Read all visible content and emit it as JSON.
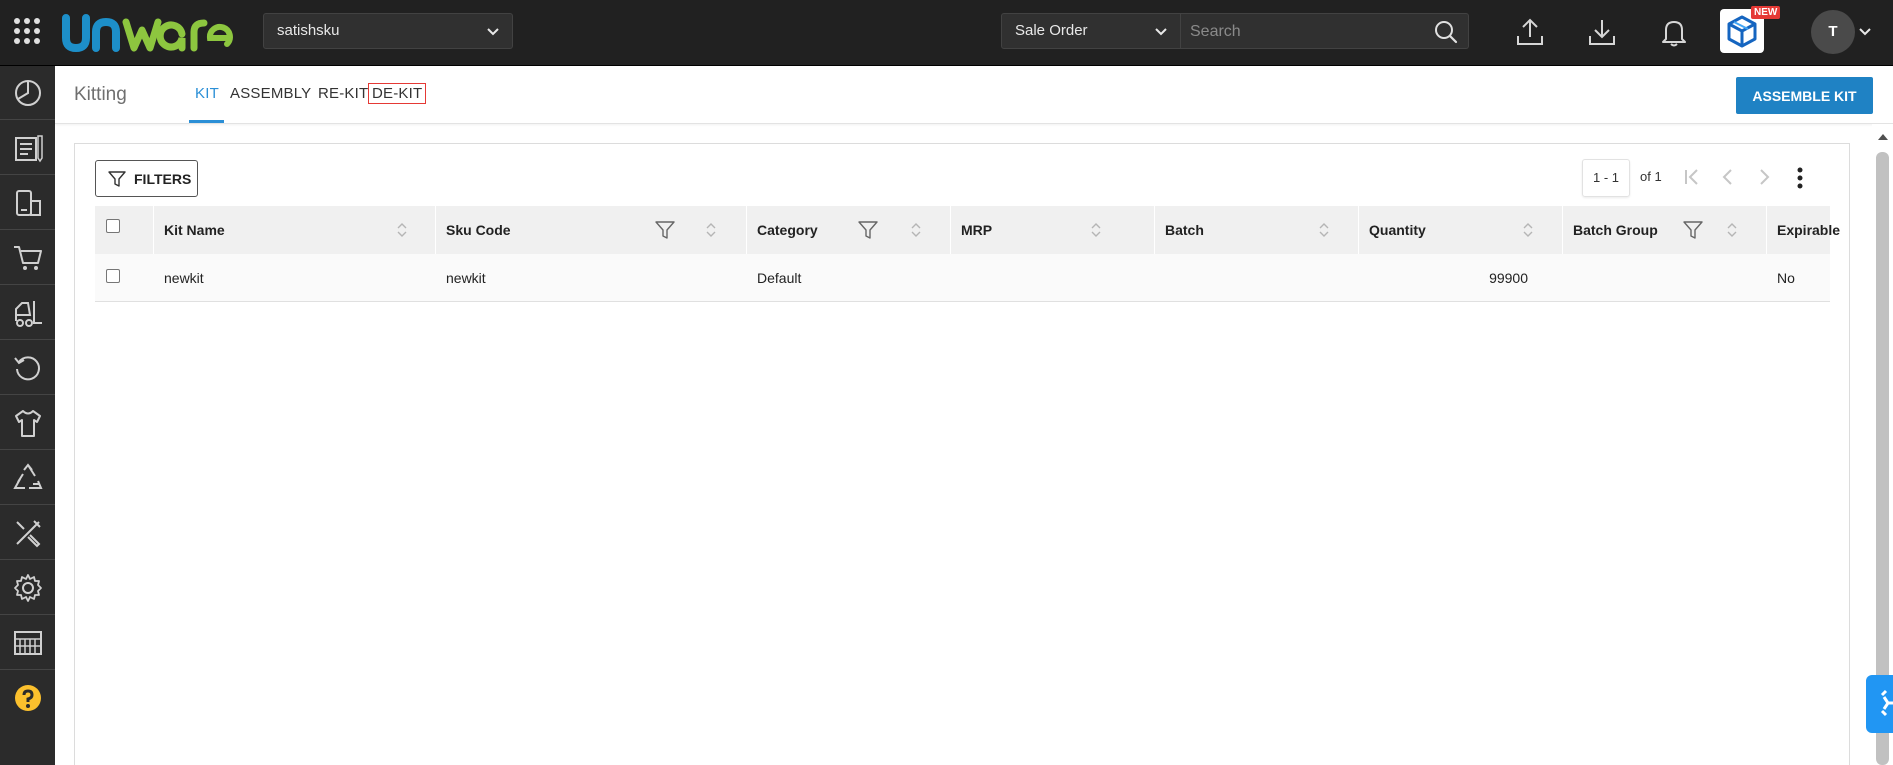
{
  "topbar": {
    "facility": "satishsku",
    "search_type": "Sale Order",
    "search_placeholder": "Search",
    "new_badge": "NEW",
    "avatar_initial": "T"
  },
  "header": {
    "title": "Kitting",
    "tabs": [
      {
        "label": "KIT",
        "active": true
      },
      {
        "label": "ASSEMBLY",
        "active": false
      },
      {
        "label": "RE-KIT",
        "active": false
      },
      {
        "label": "DE-KIT",
        "active": false
      }
    ],
    "primary_action": "ASSEMBLE KIT"
  },
  "toolbar": {
    "filters_label": "FILTERS",
    "page_range": "1 - 1",
    "page_total": "of 1"
  },
  "table": {
    "columns": [
      "Kit Name",
      "Sku Code",
      "Category",
      "MRP",
      "Batch",
      "Quantity",
      "Batch Group",
      "Expirable"
    ],
    "rows": [
      {
        "kit_name": "newkit",
        "sku_code": "newkit",
        "category": "Default",
        "mrp": "",
        "batch": "",
        "quantity": "99900",
        "batch_group": "",
        "expirable": "No"
      }
    ]
  },
  "colors": {
    "accent": "#2b8fd6",
    "primary_button": "#1f82c4",
    "topbar": "#212121",
    "sidebar": "#2b2b2b",
    "help": "#fbc02d"
  },
  "sidebar_icons": [
    "dashboard-icon",
    "orders-icon",
    "inventory-icon",
    "cart-icon",
    "forklift-icon",
    "returns-icon",
    "tshirt-icon",
    "recycle-icon",
    "tools-icon",
    "settings-icon",
    "warehouse-icon",
    "help-icon"
  ]
}
